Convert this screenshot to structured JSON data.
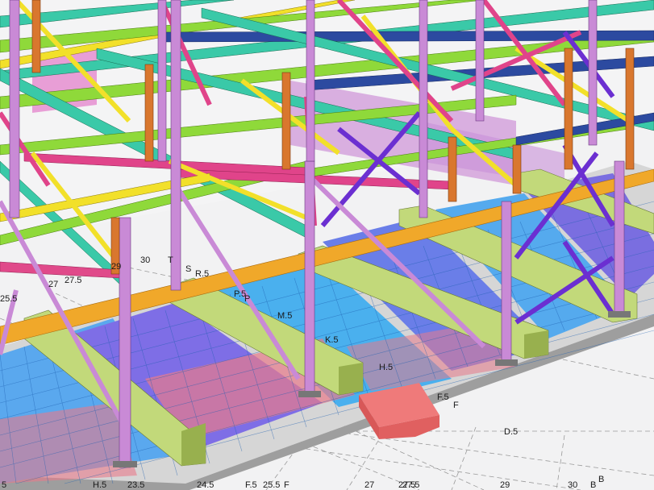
{
  "view": {
    "type": "3D structural steel model view",
    "background": "#f4f4f5",
    "ground_grid_color": "#9a9a9a"
  },
  "colors": {
    "column_purple": "#c98ad6",
    "column_orange": "#d9772e",
    "beam_cyan": "#3ac9a8",
    "beam_green": "#8fd93a",
    "beam_yellow": "#f2e02a",
    "beam_navy": "#2c4aa0",
    "beam_red": "#e04a4a",
    "bracing_magenta": "#e0448a",
    "bracing_violet": "#6b2fd1",
    "beam_orange": "#f0a82a",
    "foundation_olive": "#bfd77a",
    "foundation_grey": "#9e9e9e",
    "rebar_blue": "#2aa0f0",
    "rebar_violet": "#7a5ce0",
    "rebar_red": "#e84a60",
    "pile_cap_red": "#ea6a6a",
    "panel_pink": "#d98ed9"
  },
  "grid_labels": {
    "g29": "29",
    "g30": "30",
    "gT": "T",
    "gS": "S",
    "gR5": "R.5",
    "g27": "27",
    "g275": "27.5",
    "g255": "25.5",
    "gP5": "P.5",
    "gP": "P",
    "gM5": "M.5",
    "gK5": "K.5",
    "gH5": "H.5",
    "gF5": "F.5",
    "gF": "F",
    "gD5": "D.5",
    "bH5": "H.5",
    "b235": "23.5",
    "b245": "24.5",
    "bF5": "F.5",
    "b255": "25.5",
    "bF": "F",
    "b27": "27",
    "b275": "27.5",
    "b275b": "27.5",
    "b29": "29",
    "b30": "30",
    "bB": "B",
    "bB2": "B",
    "b5": "5"
  }
}
